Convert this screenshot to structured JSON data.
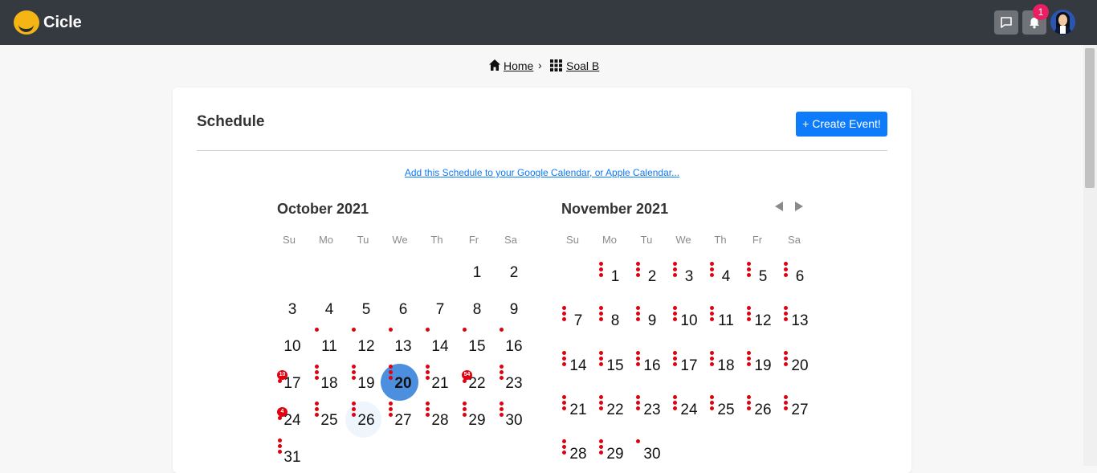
{
  "app": {
    "brand": "Cicle",
    "notification_count": "1"
  },
  "breadcrumb": {
    "home": "Home",
    "separator": "›",
    "page": "Soal B"
  },
  "schedule": {
    "title": "Schedule",
    "create_button": "+ Create Event!",
    "calendar_link": "Add this Schedule to your Google Calendar, or Apple Calendar..."
  },
  "calendars": {
    "october": {
      "title": "October 2021",
      "weekdays": [
        "Su",
        "Mo",
        "Tu",
        "We",
        "Th",
        "Fr",
        "Sa"
      ],
      "selected_day": "20",
      "highlighted_day": "26",
      "event_badges": [
        {
          "day": "17",
          "count": "10"
        },
        {
          "day": "22",
          "count": "54"
        },
        {
          "day": "24",
          "count": "4"
        }
      ]
    },
    "november": {
      "title": "November 2021",
      "weekdays": [
        "Su",
        "Mo",
        "Tu",
        "We",
        "Th",
        "Fr",
        "Sa"
      ]
    }
  },
  "colors": {
    "topbar": "#353a40",
    "accent": "#0d7bfa",
    "event_dot": "#e2000f",
    "selected_day": "#4b8fde"
  },
  "icons": {
    "chat": "chat-icon",
    "bell": "bell-icon",
    "home": "home-icon",
    "grid": "grid-icon",
    "prev": "prev-month-icon",
    "next": "next-month-icon"
  }
}
